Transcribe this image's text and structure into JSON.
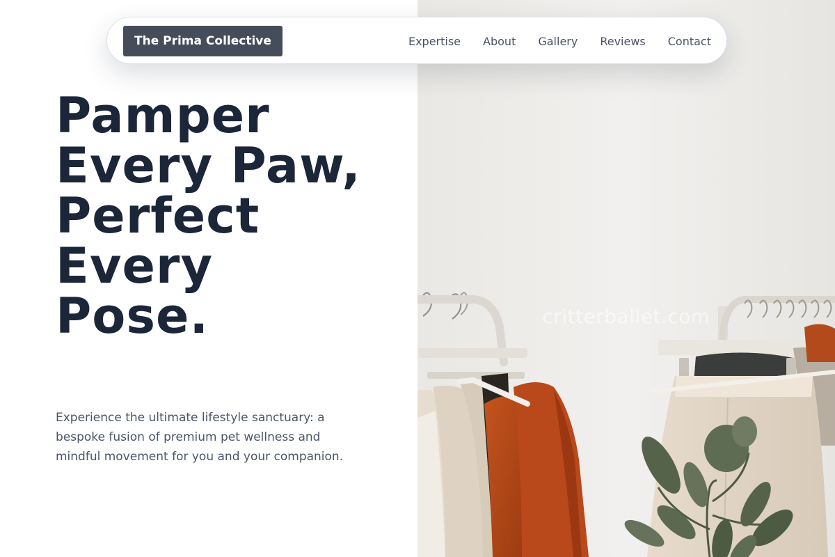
{
  "brand": {
    "name": "The Prima Collective"
  },
  "nav": {
    "links": [
      "Expertise",
      "About",
      "Gallery",
      "Reviews",
      "Contact"
    ]
  },
  "hero": {
    "title": "Pamper Every Paw, Perfect Every Pose.",
    "subtitle": "Experience the ultimate lifestyle sanctuary: a bespoke fusion of premium pet wellness and mindful movement for you and your companion."
  },
  "image": {
    "watermark": "critterballet.com",
    "icon": "clothing-rack-photo"
  },
  "colors": {
    "heading": "#1c2639",
    "brand_bg": "#454c5a",
    "nav_text": "#4a5365",
    "body_text": "#4a5568"
  }
}
